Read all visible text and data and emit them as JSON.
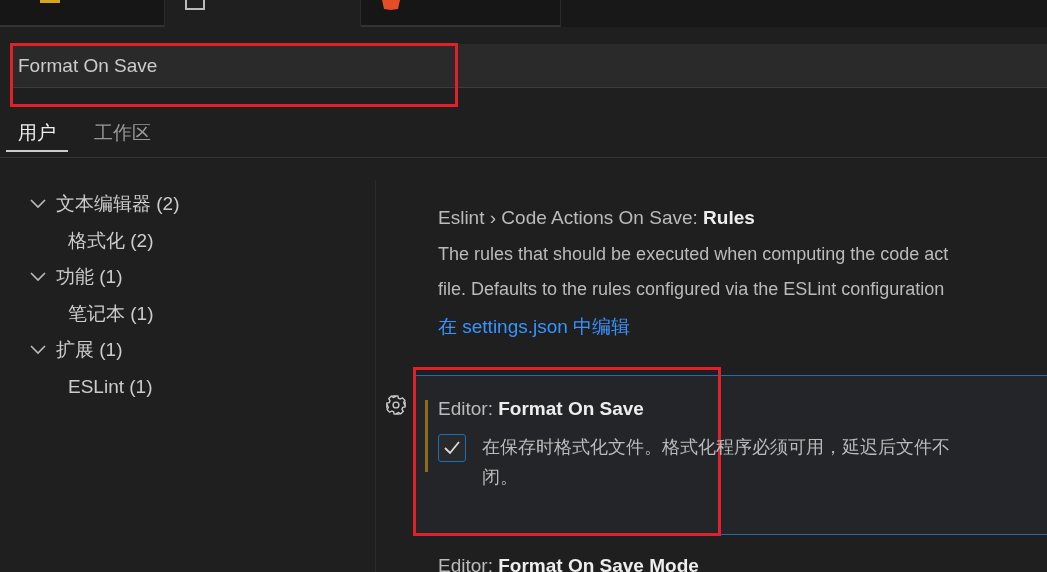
{
  "editor_tabs": [
    {
      "kind": "script",
      "selected": false
    },
    {
      "kind": "settings",
      "selected": true
    },
    {
      "kind": "html",
      "selected": false
    }
  ],
  "search": {
    "value": "Format On Save"
  },
  "scope_tabs": [
    {
      "label": "用户",
      "selected": true
    },
    {
      "label": "工作区",
      "selected": false
    }
  ],
  "toc": [
    {
      "label": "文本编辑器 (2)",
      "expanded": true,
      "children": [
        {
          "label": "格式化 (2)"
        }
      ]
    },
    {
      "label": "功能 (1)",
      "expanded": true,
      "children": [
        {
          "label": "笔记本 (1)"
        }
      ]
    },
    {
      "label": "扩展 (1)",
      "expanded": true,
      "children": [
        {
          "label": "ESLint (1)"
        }
      ]
    }
  ],
  "settings": [
    {
      "kind": "link",
      "category": "Eslint › Code Actions On Save: ",
      "name": "Rules",
      "focused": false,
      "modified": false,
      "description": [
        "The rules that should be executed when computing the code act",
        "file. Defaults to the rules configured via the ESLint configuration"
      ],
      "link": "在 settings.json 中编辑"
    },
    {
      "kind": "checkbox",
      "category": "Editor: ",
      "name": "Format On Save",
      "focused": true,
      "modified": true,
      "checked": true,
      "description": [
        "在保存时格式化文件。格式化程序必须可用，延迟后文件不",
        "闭。"
      ]
    },
    {
      "kind": "plain",
      "category": "Editor: ",
      "name": "Format On Save Mode",
      "focused": false,
      "modified": false
    }
  ]
}
